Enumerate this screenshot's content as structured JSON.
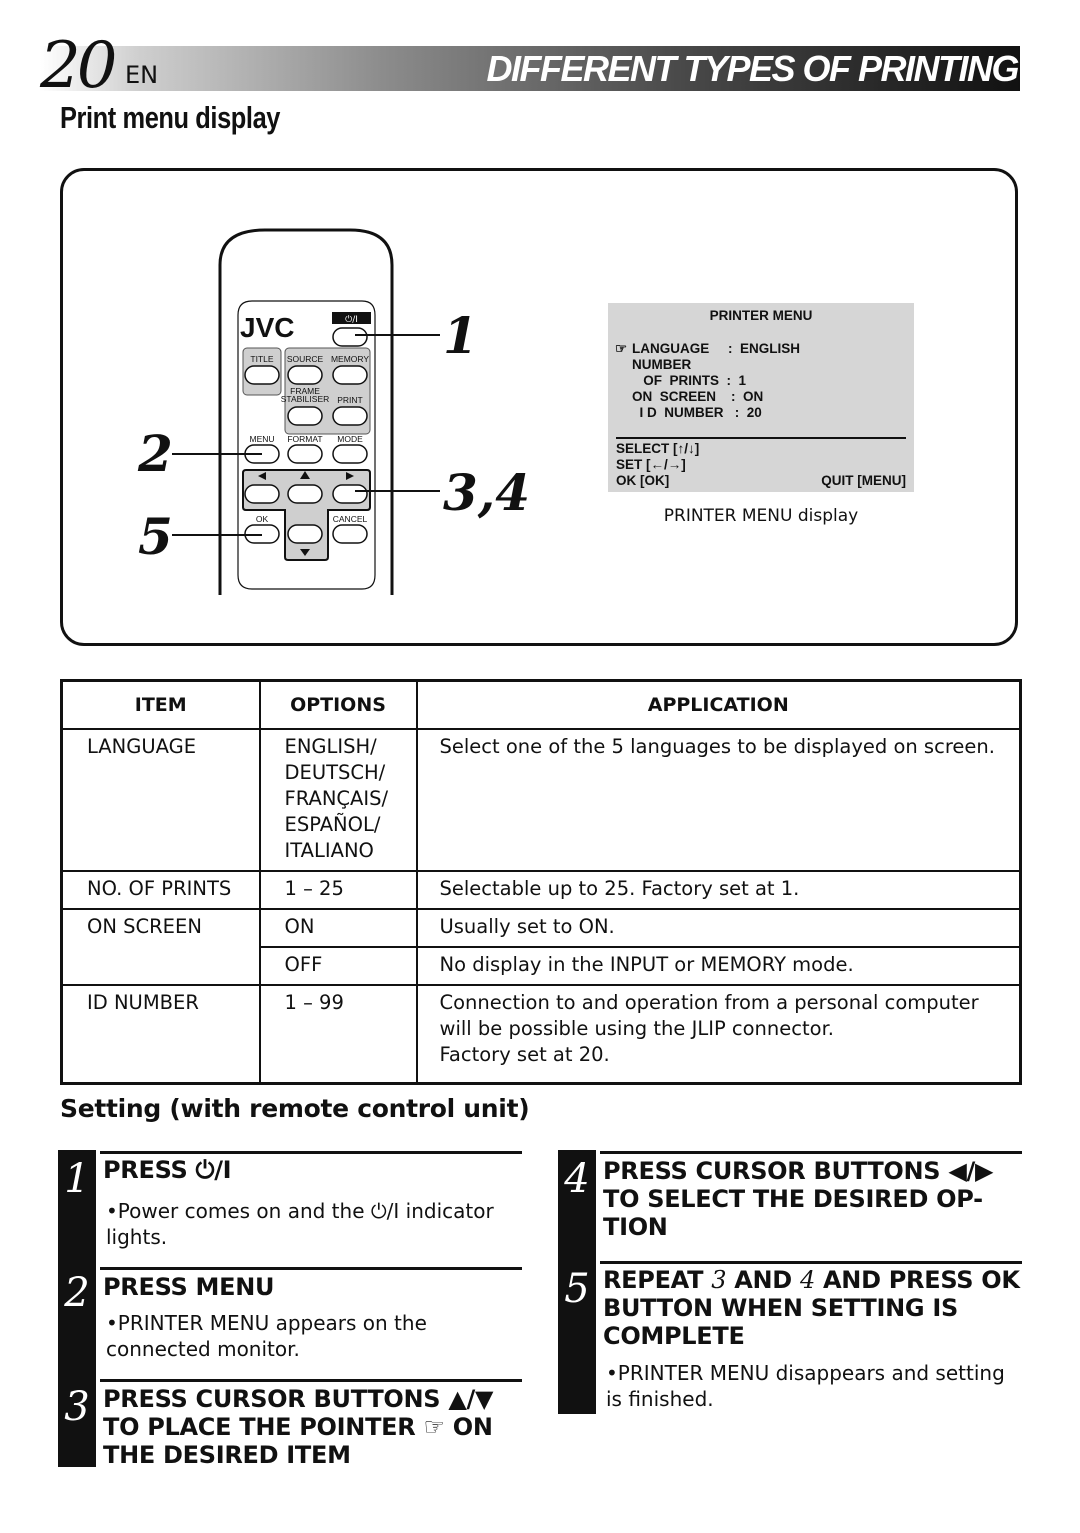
{
  "header": {
    "page_number": "20",
    "language": "EN",
    "section_title": "DIFFERENT TYPES OF PRINTING"
  },
  "subtitle": "Print menu display",
  "remote": {
    "brand": "JVC",
    "power_label": "⏻/I",
    "buttons": {
      "title": "TITLE",
      "source": "SOURCE",
      "memory": "MEMORY",
      "frame": "FRAME",
      "stabiliser": "STABILISER",
      "print": "PRINT",
      "menu": "MENU",
      "format": "FORMAT",
      "mode": "MODE",
      "ok": "OK",
      "cancel": "CANCEL"
    },
    "callouts": [
      "1",
      "2",
      "3,4",
      "5"
    ]
  },
  "osd": {
    "title": "PRINTER  MENU",
    "pointer_icon": "☞",
    "rows": [
      "LANGUAGE     :  ENGLISH",
      "NUMBER",
      "   OF  PRINTS  :  1",
      "ON  SCREEN    :  ON",
      "  I D  NUMBER   :  20"
    ],
    "footer": {
      "select": "SELECT [↑/↓]",
      "set": "SET [←/→]",
      "ok": "OK [OK]",
      "quit": "QUIT [MENU]"
    },
    "caption": "PRINTER MENU display"
  },
  "table": {
    "headers": [
      "ITEM",
      "OPTIONS",
      "APPLICATION"
    ],
    "rows": [
      {
        "item": "LANGUAGE",
        "options": [
          "ENGLISH/",
          "DEUTSCH/",
          "FRANÇAIS/",
          "ESPAÑOL/",
          "ITALIANO"
        ],
        "application": [
          "Select one of the 5 languages to be displayed on screen."
        ]
      },
      {
        "item": "NO. OF PRINTS",
        "options": [
          "1 – 25"
        ],
        "application": [
          "Selectable up to 25.  Factory set at 1."
        ]
      },
      {
        "item": "ON SCREEN",
        "options": [
          "ON"
        ],
        "application": [
          "Usually set to ON."
        ]
      },
      {
        "item": "",
        "options": [
          "OFF"
        ],
        "application": [
          "No display in the INPUT or MEMORY mode."
        ]
      },
      {
        "item": "ID NUMBER",
        "options": [
          "1 – 99"
        ],
        "application": [
          "Connection to and operation from a personal computer",
          "will be possible using the JLIP connector.",
          "Factory set at 20."
        ]
      }
    ]
  },
  "setting": {
    "title": "Setting (with remote control unit)",
    "steps": [
      {
        "num": "1",
        "head": "PRESS ⏻/I",
        "body": "•Power comes on and the ⏻/I indicator lights."
      },
      {
        "num": "2",
        "head": "PRESS MENU",
        "body": "•PRINTER MENU appears on the connected monitor."
      },
      {
        "num": "3",
        "head": "PRESS CURSOR BUTTONS ▲/▼ TO PLACE THE POINTER ☞ ON THE DESIRED ITEM",
        "body": ""
      },
      {
        "num": "4",
        "head": "PRESS CURSOR BUTTONS ◀/▶ TO SELECT THE DESIRED OP- TION",
        "body": ""
      },
      {
        "num": "5",
        "head_parts": [
          "REPEAT ",
          "3",
          " AND ",
          "4",
          " AND PRESS OK BUTTON WHEN SETTING IS COMPLETE"
        ],
        "body": "•PRINTER MENU disappears and setting is finished."
      }
    ]
  }
}
